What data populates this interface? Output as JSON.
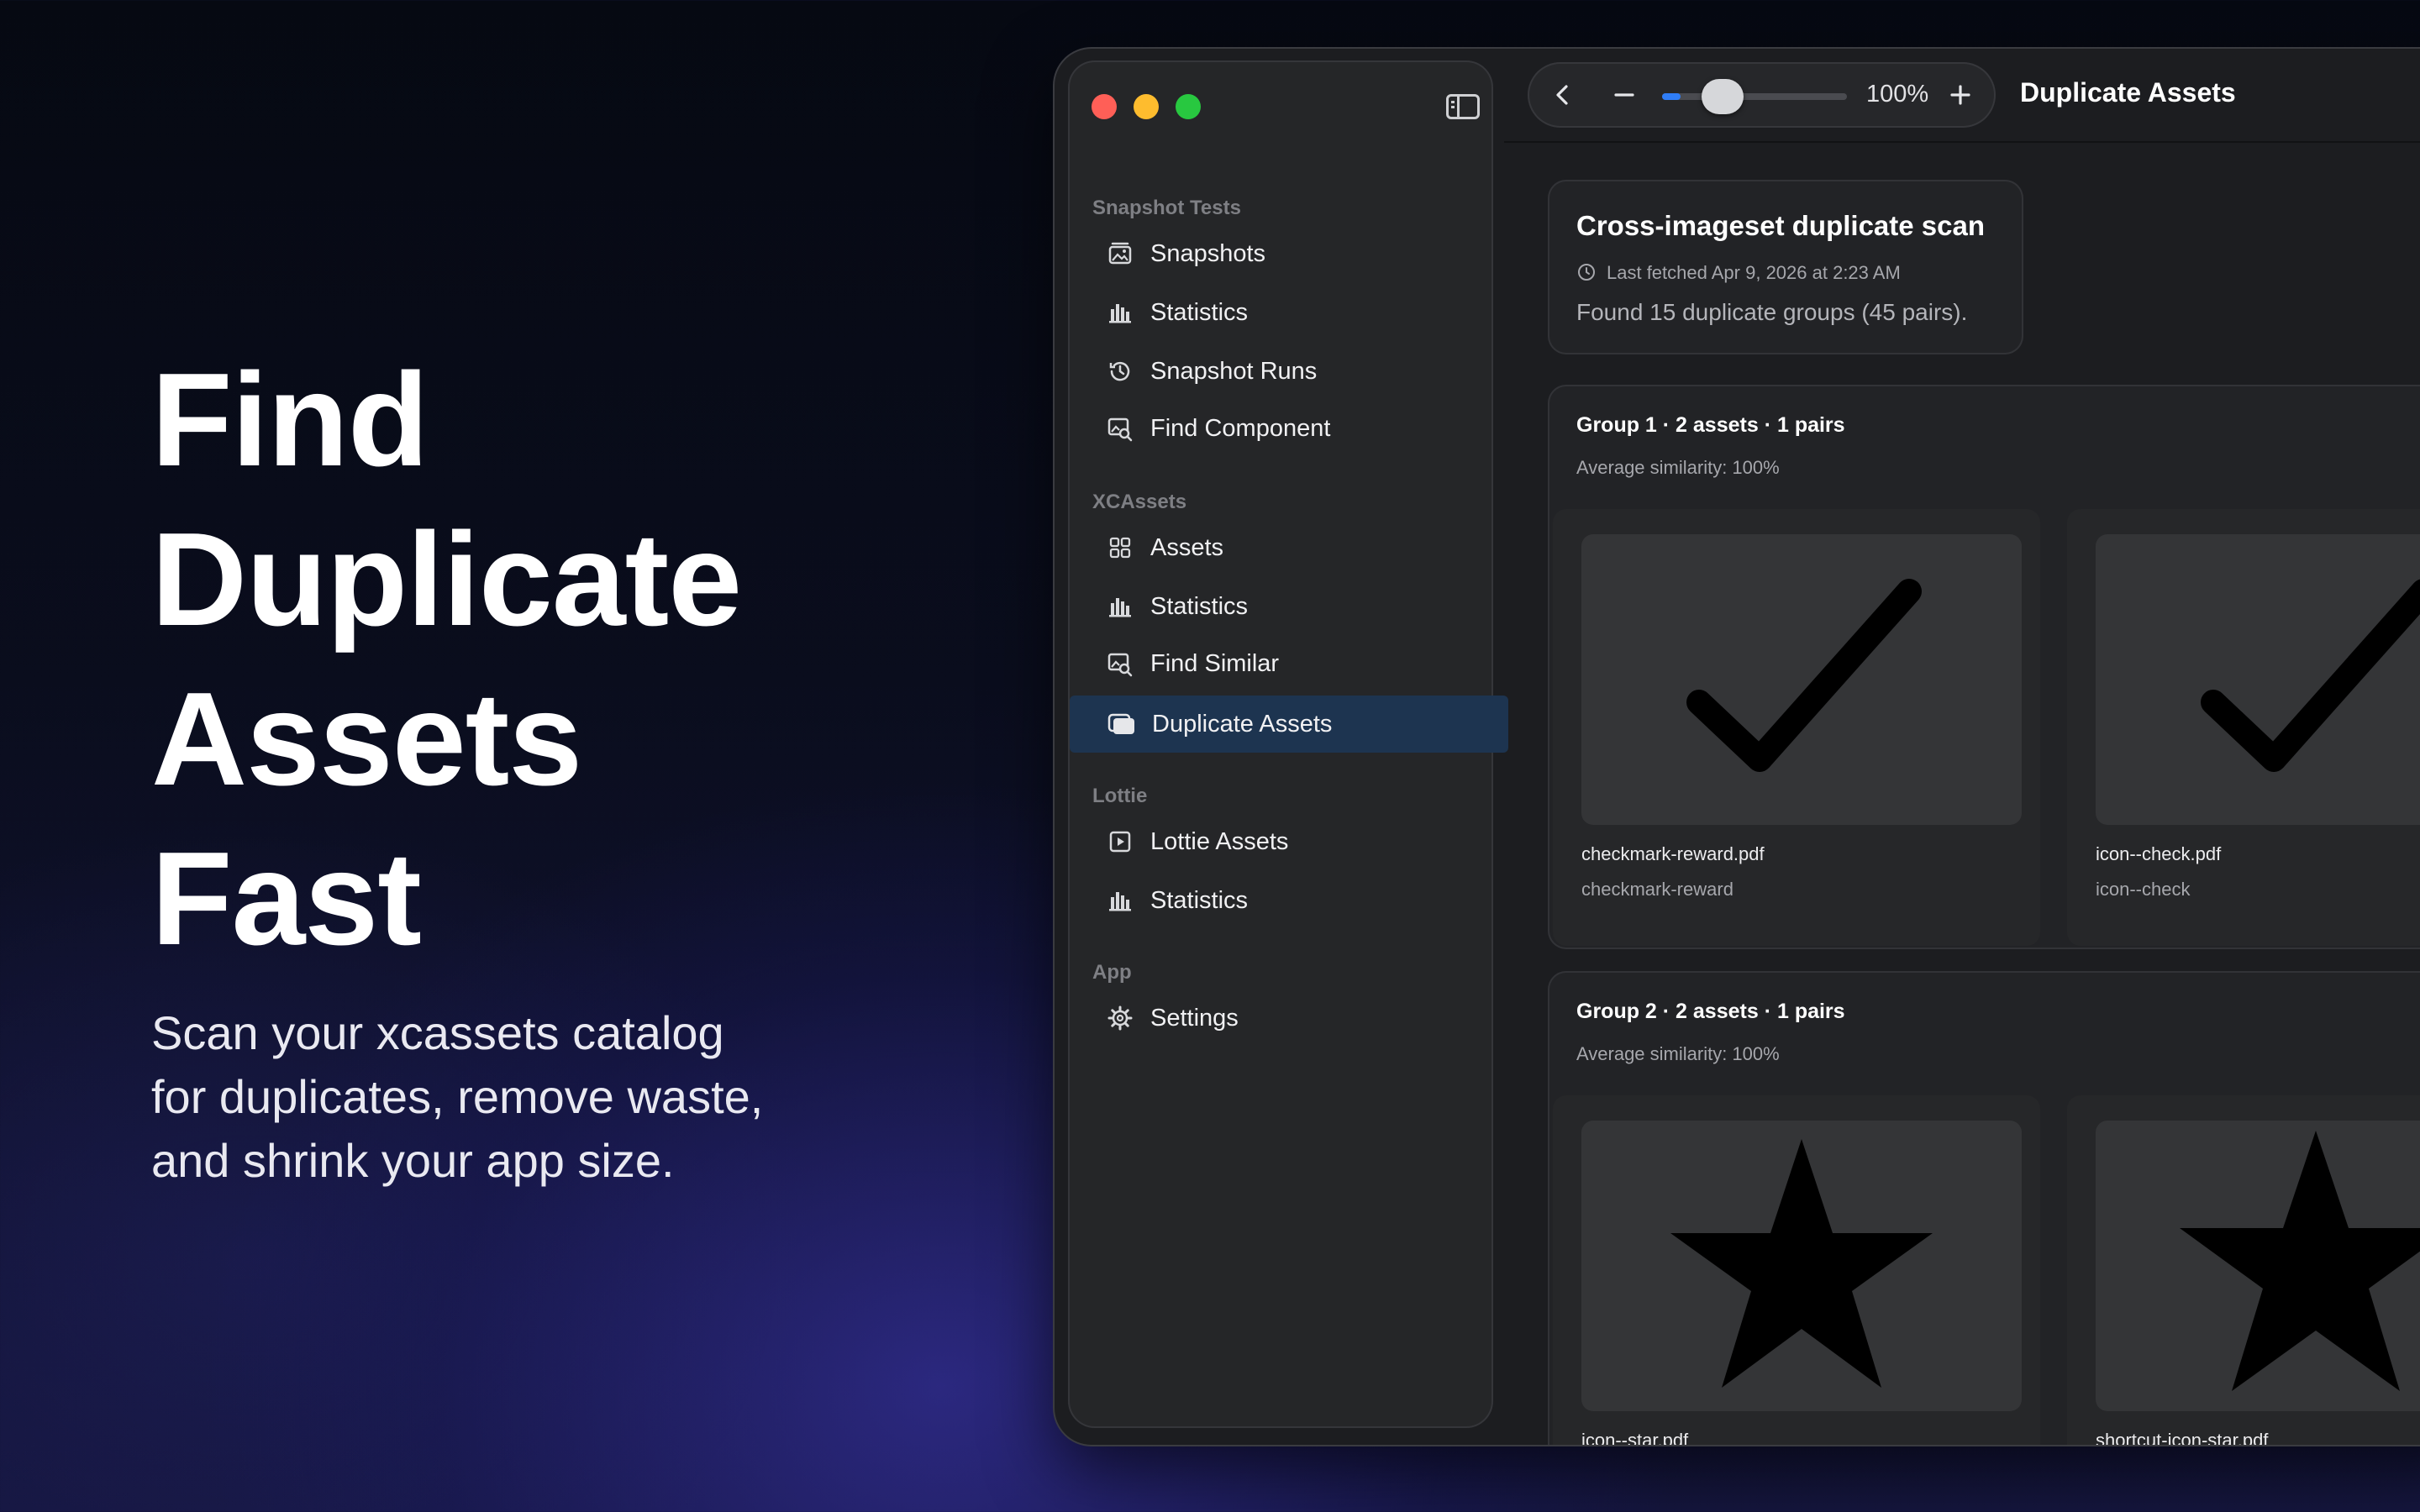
{
  "hero": {
    "title_lines": [
      "Find",
      "Duplicate",
      "Assets",
      "Fast"
    ],
    "subtitle_lines": [
      "Scan your xcassets catalog",
      "for duplicates, remove waste,",
      "and shrink your app size."
    ]
  },
  "window": {
    "title": "Duplicate Assets",
    "zoom_label": "100%",
    "zoom_level": 0.1
  },
  "sidebar": {
    "sections": [
      {
        "label": "Snapshot Tests",
        "items": [
          {
            "label": "Snapshots",
            "icon": "photo-stack-icon"
          },
          {
            "label": "Statistics",
            "icon": "bar-chart-icon"
          },
          {
            "label": "Snapshot Runs",
            "icon": "history-clock-icon"
          },
          {
            "label": "Find Component",
            "icon": "image-search-icon"
          }
        ]
      },
      {
        "label": "XCAssets",
        "items": [
          {
            "label": "Assets",
            "icon": "grid-icon"
          },
          {
            "label": "Statistics",
            "icon": "bar-chart-icon"
          },
          {
            "label": "Find Similar",
            "icon": "image-search-icon"
          },
          {
            "label": "Duplicate Assets",
            "icon": "duplicate-icon",
            "selected": true
          }
        ]
      },
      {
        "label": "Lottie",
        "items": [
          {
            "label": "Lottie Assets",
            "icon": "play-square-icon"
          },
          {
            "label": "Statistics",
            "icon": "bar-chart-icon"
          }
        ]
      },
      {
        "label": "App",
        "items": [
          {
            "label": "Settings",
            "icon": "gear-icon"
          }
        ]
      }
    ]
  },
  "scan": {
    "title": "Cross-imageset duplicate scan",
    "last_fetched": "Last fetched  Apr 9, 2026 at 2:23 AM",
    "found": "Found 15 duplicate groups (45 pairs)."
  },
  "groups": [
    {
      "title": "Group 1 · 2 assets · 1 pairs",
      "similarity": "Average similarity: 100%",
      "assets": [
        {
          "file": "checkmark-reward.pdf",
          "name": "checkmark-reward",
          "icon": "checkmark-icon"
        },
        {
          "file": "icon--check.pdf",
          "name": "icon--check",
          "icon": "checkmark-icon"
        }
      ]
    },
    {
      "title": "Group 2 · 2 assets · 1 pairs",
      "similarity": "Average similarity: 100%",
      "assets": [
        {
          "file": "icon--star.pdf",
          "name": "",
          "icon": "star-icon"
        },
        {
          "file": "shortcut-icon-star.pdf",
          "name": "",
          "icon": "star-icon"
        }
      ]
    }
  ],
  "colors": {
    "accent": "#2f7df6",
    "selected_row": "#1d3450",
    "traffic_red": "#ff5f57",
    "traffic_yellow": "#febc2e",
    "traffic_green": "#28c840"
  }
}
